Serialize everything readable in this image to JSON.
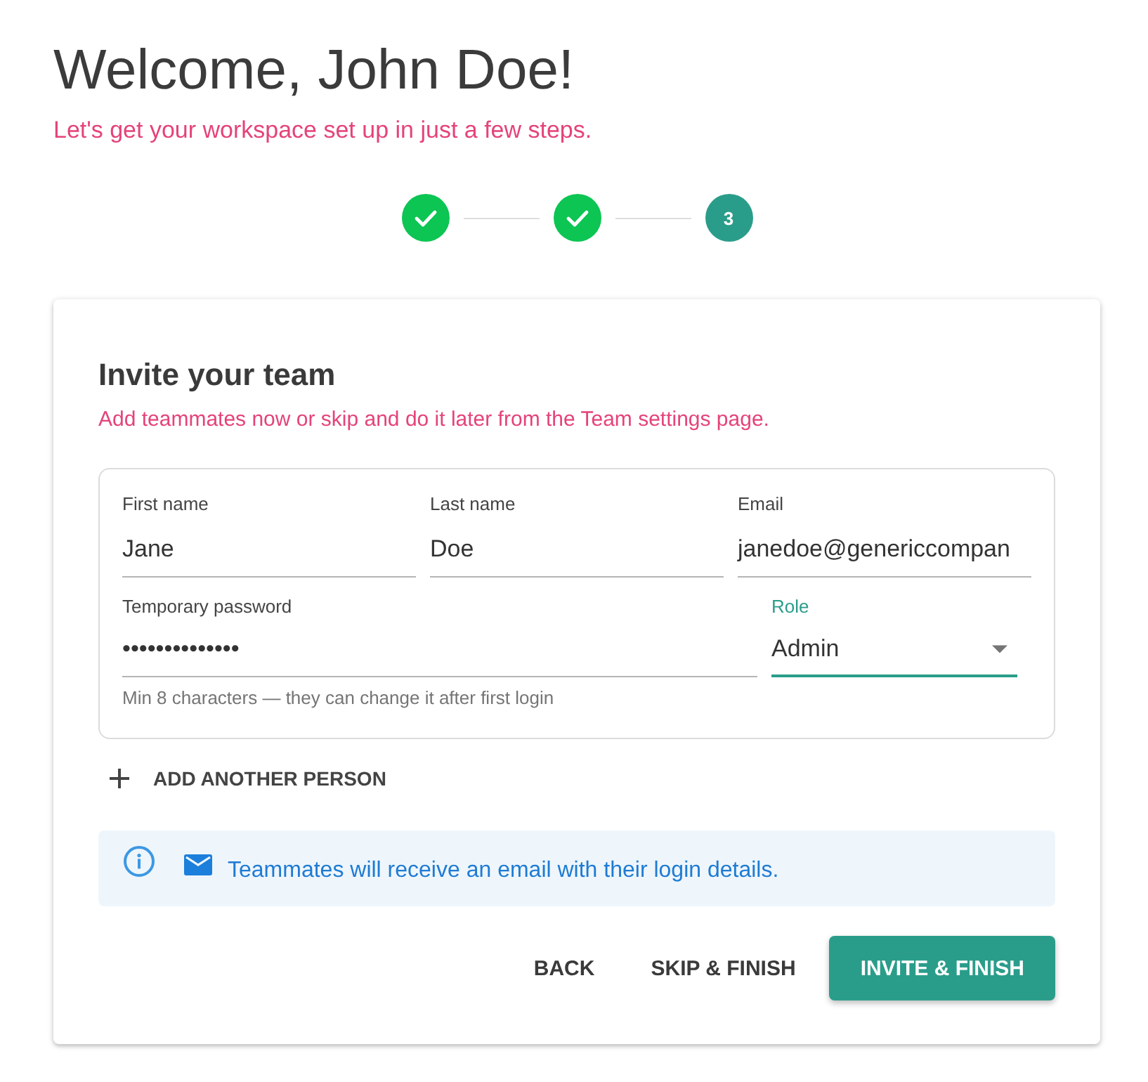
{
  "header": {
    "title": "Welcome, John Doe!",
    "subtitle": "Let's get your workspace set up in just a few steps."
  },
  "stepper": {
    "steps": [
      {
        "completed": true
      },
      {
        "completed": true
      },
      {
        "completed": false,
        "label": "3"
      }
    ]
  },
  "card": {
    "title": "Invite your team",
    "description": "Add teammates now or skip and do it later from the Team settings page.",
    "person": {
      "fields": [
        {
          "kind": "text",
          "label": "First name",
          "value": "Jane",
          "focused": false
        },
        {
          "kind": "text",
          "label": "Last name",
          "value": "Doe",
          "focused": false
        },
        {
          "kind": "text",
          "label": "Email",
          "value": "janedoe@genericcompan",
          "focused": false
        },
        {
          "kind": "password",
          "label": "Temporary password",
          "value": "••••••••••••••",
          "helper": "Min 8 characters — they can change it after first login",
          "focused": false
        },
        {
          "kind": "select",
          "label": "Role",
          "value": "Admin",
          "focused": true
        }
      ]
    },
    "add_button": {
      "label": "ADD ANOTHER PERSON"
    },
    "notice": {
      "text": "Teammates will receive an email with their login details."
    },
    "actions": [
      {
        "label": "BACK",
        "kind": "text"
      },
      {
        "label": "SKIP & FINISH",
        "kind": "text"
      },
      {
        "label": "INVITE & FINISH",
        "kind": "primary"
      }
    ]
  }
}
